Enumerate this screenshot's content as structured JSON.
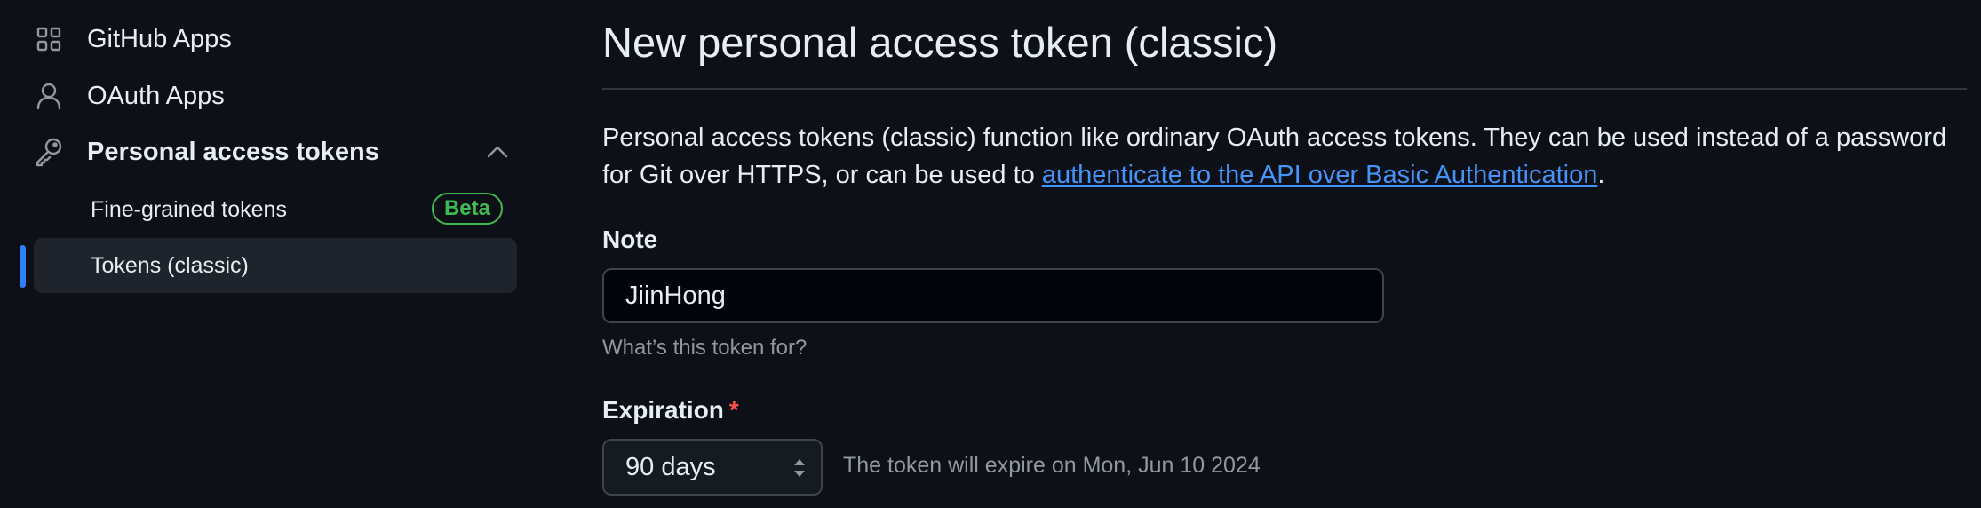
{
  "sidebar": {
    "items": [
      {
        "label": "GitHub Apps",
        "icon": "apps-grid-icon"
      },
      {
        "label": "OAuth Apps",
        "icon": "person-icon"
      },
      {
        "label": "Personal access tokens",
        "icon": "key-icon",
        "expanded": true
      }
    ],
    "subitems": [
      {
        "label": "Fine-grained tokens",
        "badge": "Beta"
      },
      {
        "label": "Tokens (classic)",
        "active": true
      }
    ]
  },
  "main": {
    "title": "New personal access token (classic)",
    "description_before": "Personal access tokens (classic) function like ordinary OAuth access tokens. They can be used instead of a password for Git over HTTPS, or can be used to ",
    "description_link": "authenticate to the API over Basic Authentication",
    "description_after": ".",
    "note": {
      "label": "Note",
      "value": "JiinHong",
      "hint": "What’s this token for?"
    },
    "expiration": {
      "label": "Expiration",
      "required_mark": "*",
      "selected": "90 days",
      "info": "The token will expire on Mon, Jun 10 2024"
    }
  },
  "colors": {
    "background": "#0d1117",
    "link": "#4493f8",
    "active_indicator": "#2f81f7",
    "beta_badge": "#3fb950",
    "required": "#f85149"
  }
}
